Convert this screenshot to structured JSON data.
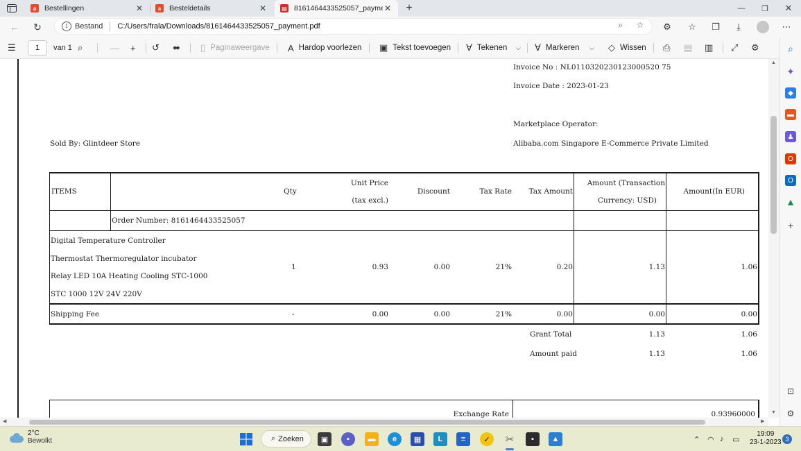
{
  "browser": {
    "tabs": [
      {
        "label": "Bestellingen",
        "icon": "aliexpress-icon",
        "active": false
      },
      {
        "label": "Besteldetails",
        "icon": "aliexpress-icon",
        "active": false
      },
      {
        "label": "8161464433525057_payment.pdf",
        "icon": "pdf-icon",
        "active": true
      }
    ],
    "address": {
      "site_label": "Bestand",
      "url": "C:/Users/frala/Downloads/8161464433525057_payment.pdf"
    }
  },
  "pdf_toolbar": {
    "page_number": "1",
    "page_total": "van 1",
    "page_view": "Paginaweergave",
    "read_aloud": "Hardop voorlezen",
    "add_text": "Tekst toevoegen",
    "draw": "Tekenen",
    "highlight": "Markeren",
    "erase": "Wissen"
  },
  "invoice": {
    "invoice_no": "Invoice No : NL0110320230123000520 75",
    "invoice_date": "Invoice Date : 2023-01-23",
    "marketplace_label": "Marketplace Operator:",
    "marketplace_value": "Alibaba.com Singapore E-Commerce Private Limited",
    "sold_by": "Sold By:   Glintdeer Store",
    "headers": {
      "items": "ITEMS",
      "qty": "Qty",
      "unit_price_1": "Unit Price",
      "unit_price_2": "(tax excl.)",
      "discount": "Discount",
      "tax_rate": "Tax Rate",
      "tax_amount": "Tax Amount",
      "amount_usd_1": "Amount (Transaction",
      "amount_usd_2": "Currency: USD)",
      "amount_eur": "Amount(In EUR)"
    },
    "order_number": "Order Number: 8161464433525057",
    "product": {
      "lines": [
        "Digital Temperature Controller",
        "Thermostat Thermoregulator incubator",
        "Relay LED 10A Heating Cooling STC-1000",
        "STC 1000 12V 24V 220V"
      ],
      "qty": "1",
      "unit_price": "0.93",
      "discount": "0.00",
      "tax_rate": "21%",
      "tax_amount": "0.20",
      "amount_usd": "1.13",
      "amount_eur": "1.06"
    },
    "shipping": {
      "label": "Shipping Fee",
      "qty": "-",
      "unit_price": "0.00",
      "discount": "0.00",
      "tax_rate": "21%",
      "tax_amount": "0.00",
      "amount_usd": "0.00",
      "amount_eur": "0.00"
    },
    "grant_total": {
      "label": "Grant Total",
      "usd": "1.13",
      "eur": "1.06"
    },
    "amount_paid": {
      "label": "Amount paid",
      "usd": "1.13",
      "eur": "1.06"
    },
    "exchange_rate": {
      "label": "Exchange Rate",
      "value": "0.93960000"
    }
  },
  "taskbar": {
    "weather_temp": "2°C",
    "weather_desc": "Bewolkt",
    "search_label": "Zoeken",
    "time": "19:09",
    "date": "23-1-2023",
    "notification_count": "3"
  }
}
